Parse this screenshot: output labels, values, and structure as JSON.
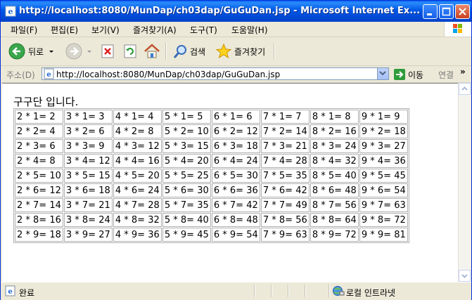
{
  "window": {
    "title": "http://localhost:8080/MunDap/ch03dap/GuGuDan.jsp - Microsoft Internet Ex..."
  },
  "menu": [
    "파일(F)",
    "편집(E)",
    "보기(V)",
    "즐겨찾기(A)",
    "도구(T)",
    "도움말(H)"
  ],
  "toolbar": {
    "back_label": "뒤로",
    "search_label": "검색",
    "favorites_label": "즐겨찾기"
  },
  "address": {
    "label": "주소(D)",
    "url": "http://localhost:8080/MunDap/ch03dap/GuGuDan.jsp",
    "go_label": "이동",
    "links_label": "연결",
    "more": "»"
  },
  "page": {
    "heading": "구구단 입니다."
  },
  "table": [
    [
      "2 * 1= 2",
      "3 * 1= 3",
      "4 * 1= 4",
      "5 * 1= 5",
      "6 * 1= 6",
      "7 * 1= 7",
      "8 * 1= 8",
      "9 * 1= 9"
    ],
    [
      "2 * 2= 4",
      "3 * 2= 6",
      "4 * 2= 8",
      "5 * 2= 10",
      "6 * 2= 12",
      "7 * 2= 14",
      "8 * 2= 16",
      "9 * 2= 18"
    ],
    [
      "2 * 3= 6",
      "3 * 3= 9",
      "4 * 3= 12",
      "5 * 3= 15",
      "6 * 3= 18",
      "7 * 3= 21",
      "8 * 3= 24",
      "9 * 3= 27"
    ],
    [
      "2 * 4= 8",
      "3 * 4= 12",
      "4 * 4= 16",
      "5 * 4= 20",
      "6 * 4= 24",
      "7 * 4= 28",
      "8 * 4= 32",
      "9 * 4= 36"
    ],
    [
      "2 * 5= 10",
      "3 * 5= 15",
      "4 * 5= 20",
      "5 * 5= 25",
      "6 * 5= 30",
      "7 * 5= 35",
      "8 * 5= 40",
      "9 * 5= 45"
    ],
    [
      "2 * 6= 12",
      "3 * 6= 18",
      "4 * 6= 24",
      "5 * 6= 30",
      "6 * 6= 36",
      "7 * 6= 42",
      "8 * 6= 48",
      "9 * 6= 54"
    ],
    [
      "2 * 7= 14",
      "3 * 7= 21",
      "4 * 7= 28",
      "5 * 7= 35",
      "6 * 7= 42",
      "7 * 7= 49",
      "8 * 7= 56",
      "9 * 7= 63"
    ],
    [
      "2 * 8= 16",
      "3 * 8= 24",
      "4 * 8= 32",
      "5 * 8= 40",
      "6 * 8= 48",
      "7 * 8= 56",
      "8 * 8= 64",
      "9 * 8= 72"
    ],
    [
      "2 * 9= 18",
      "3 * 9= 27",
      "4 * 9= 36",
      "5 * 9= 45",
      "6 * 9= 54",
      "7 * 9= 63",
      "8 * 9= 72",
      "9 * 9= 81"
    ]
  ],
  "status": {
    "text": "완료",
    "zone": "로컬 인트라넷"
  },
  "colors": {
    "titlebar": "#0058e6",
    "chrome": "#ece9d8",
    "grid_border": "#b0b0b0"
  }
}
